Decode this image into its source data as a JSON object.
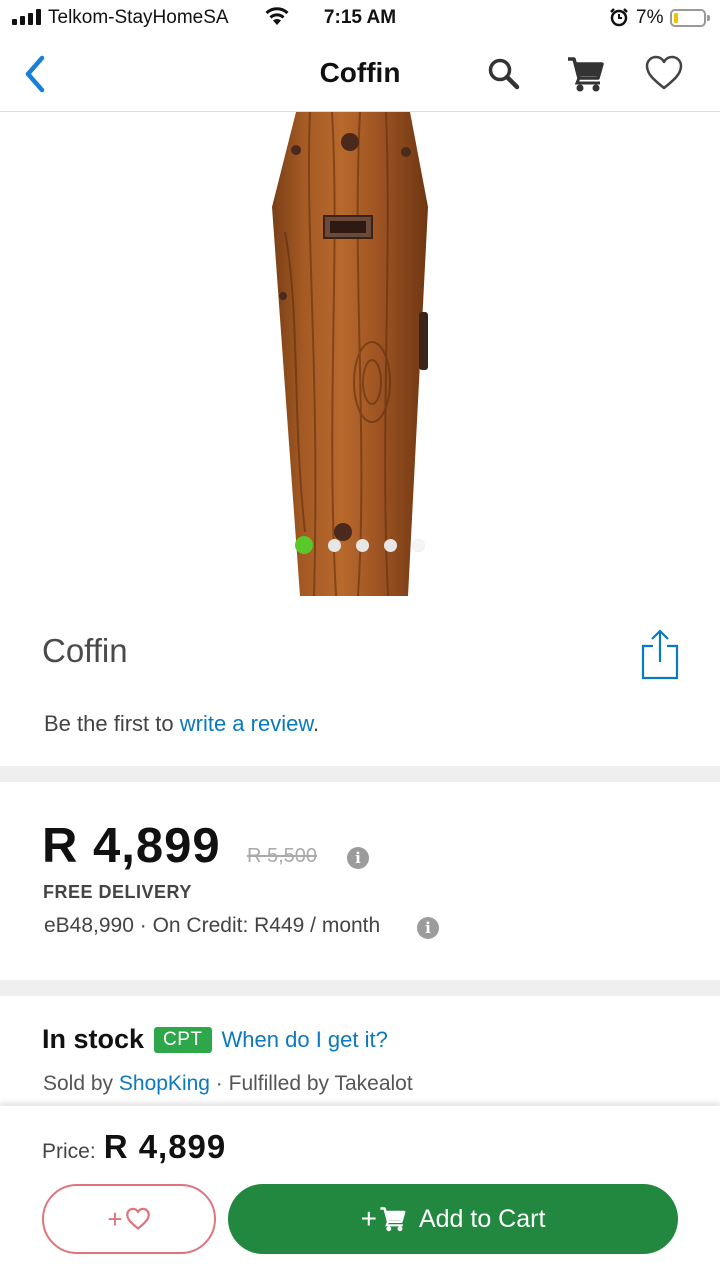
{
  "status_bar": {
    "carrier": "Telkom-StayHomeSA",
    "time": "7:15 AM",
    "battery": "7%"
  },
  "nav": {
    "title": "Coffin"
  },
  "gallery": {
    "image_count": 5,
    "active_index": 0
  },
  "product": {
    "title": "Coffin",
    "review_prefix": "Be the first to ",
    "review_link": "write a review",
    "review_suffix": "."
  },
  "pricing": {
    "price": "R 4,899",
    "old_price": "R 5,500",
    "delivery": "FREE DELIVERY",
    "credit": "eB48,990 · On Credit: R449 / month"
  },
  "stock": {
    "status": "In stock",
    "location_badge": "CPT",
    "when_link": "When do I get it?",
    "sold_by_prefix": "Sold by ",
    "seller": "ShopKing",
    "fulfilled": " · Fulfilled by Takealot"
  },
  "bottom_bar": {
    "price_label": "Price:",
    "price_value": "R 4,899",
    "wishlist_plus": "+",
    "add_to_cart_plus": "+",
    "add_to_cart_label": "Add to Cart"
  },
  "colors": {
    "link_blue": "#0b79bf",
    "cart_green": "#22883f",
    "badge_green": "#2ea64a",
    "wish_pink": "#e0747e",
    "active_dot": "#5ac82b"
  }
}
